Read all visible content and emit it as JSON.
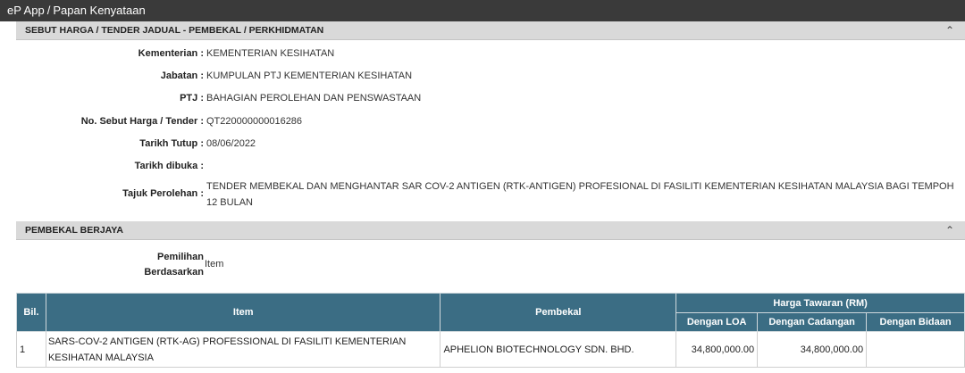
{
  "topbar": {
    "app": "eP App",
    "separator": "/",
    "page": "Papan Kenyataan"
  },
  "section1": {
    "title": "SEBUT HARGA / TENDER JADUAL - PEMBEKAL / PERKHIDMATAN",
    "toggle_icon": "chevron-up-icon",
    "fields": {
      "kementerian": {
        "label": "Kementerian :",
        "value": "KEMENTERIAN KESIHATAN"
      },
      "jabatan": {
        "label": "Jabatan :",
        "value": "KUMPULAN PTJ KEMENTERIAN KESIHATAN"
      },
      "ptj": {
        "label": "PTJ :",
        "value": "BAHAGIAN PEROLEHAN DAN PENSWASTAAN"
      },
      "no_sebut_harga": {
        "label": "No. Sebut Harga / Tender :",
        "value": "QT220000000016286"
      },
      "tarikh_tutup": {
        "label": "Tarikh Tutup :",
        "value": "08/06/2022"
      },
      "tarikh_dibuka": {
        "label": "Tarikh dibuka :",
        "value": ""
      },
      "tajuk_perolehan": {
        "label": "Tajuk Perolehan :",
        "value": "TENDER MEMBEKAL DAN MENGHANTAR SAR COV-2 ANTIGEN (RTK-ANTIGEN) PROFESIONAL DI FASILITI KEMENTERIAN KESIHATAN MALAYSIA BAGI TEMPOH 12 BULAN"
      }
    }
  },
  "section2": {
    "title": "PEMBEKAL BERJAYA",
    "toggle_icon": "chevron-up-icon",
    "pemilihan": {
      "label_line1": "Pemilihan",
      "label_line2": "Berdasarkan",
      "value": "Item"
    },
    "table": {
      "headers": {
        "bil": "Bil.",
        "item": "Item",
        "pembekal": "Pembekal",
        "harga_group": "Harga Tawaran (RM)",
        "dengan_loa": "Dengan LOA",
        "dengan_cadangan": "Dengan Cadangan",
        "dengan_bidaan": "Dengan Bidaan"
      },
      "rows": [
        {
          "bil": "1",
          "item": "SARS-COV-2 ANTIGEN (RTK-AG) PROFESSIONAL DI FASILITI KEMENTERIAN KESIHATAN MALAYSIA",
          "pembekal": "APHELION BIOTECHNOLOGY SDN. BHD.",
          "dengan_loa": "34,800,000.00",
          "dengan_cadangan": "34,800,000.00",
          "dengan_bidaan": ""
        }
      ]
    }
  }
}
